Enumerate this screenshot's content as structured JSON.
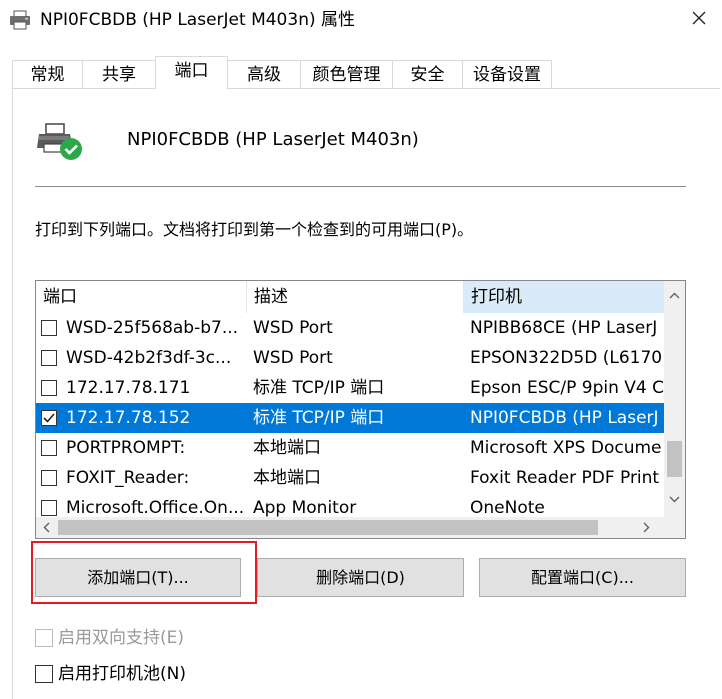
{
  "window": {
    "title": "NPI0FCBDB (HP LaserJet M403n) 属性",
    "close_symbol": "✕"
  },
  "tabs": [
    {
      "label": "常规"
    },
    {
      "label": "共享"
    },
    {
      "label": "端口"
    },
    {
      "label": "高级"
    },
    {
      "label": "颜色管理"
    },
    {
      "label": "安全"
    },
    {
      "label": "设备设置"
    }
  ],
  "active_tab": "端口",
  "header": {
    "printer_name": "NPI0FCBDB (HP LaserJet M403n)",
    "description": "打印到下列端口。文档将打印到第一个检查到的可用端口(P)。"
  },
  "port_list": {
    "columns": [
      "端口",
      "描述",
      "打印机"
    ],
    "sorted_column": "打印机",
    "rows": [
      {
        "checked": false,
        "port": "WSD-25f568ab-b7...",
        "desc": "WSD Port",
        "printer": "NPIBB68CE (HP LaserJ",
        "selected": false
      },
      {
        "checked": false,
        "port": "WSD-42b2f3df-3c...",
        "desc": "WSD Port",
        "printer": "EPSON322D5D (L6170",
        "selected": false
      },
      {
        "checked": false,
        "port": "172.17.78.171",
        "desc": "标准 TCP/IP 端口",
        "printer": "Epson ESC/P 9pin V4 C",
        "selected": false
      },
      {
        "checked": true,
        "port": "172.17.78.152",
        "desc": "标准 TCP/IP 端口",
        "printer": "NPI0FCBDB (HP LaserJ",
        "selected": true
      },
      {
        "checked": false,
        "port": "PORTPROMPT:",
        "desc": "本地端口",
        "printer": "Microsoft XPS Docume",
        "selected": false
      },
      {
        "checked": false,
        "port": "FOXIT_Reader:",
        "desc": "本地端口",
        "printer": "Foxit Reader PDF Print",
        "selected": false
      },
      {
        "checked": false,
        "port": "Microsoft.Office.On...",
        "desc": "App Monitor",
        "printer": "OneNote",
        "selected": false
      }
    ]
  },
  "buttons": {
    "add_port": "添加端口(T)...",
    "delete_port": "删除端口(D)",
    "config_port": "配置端口(C)..."
  },
  "options": {
    "bidirectional": {
      "label": "启用双向支持(E)",
      "checked": false,
      "enabled": false
    },
    "printer_pool": {
      "label": "启用打印机池(N)",
      "checked": false,
      "enabled": true
    }
  },
  "colors": {
    "selection": "#0078d7",
    "highlight_box": "#e31d1d",
    "check_green": "#2ca84a"
  }
}
